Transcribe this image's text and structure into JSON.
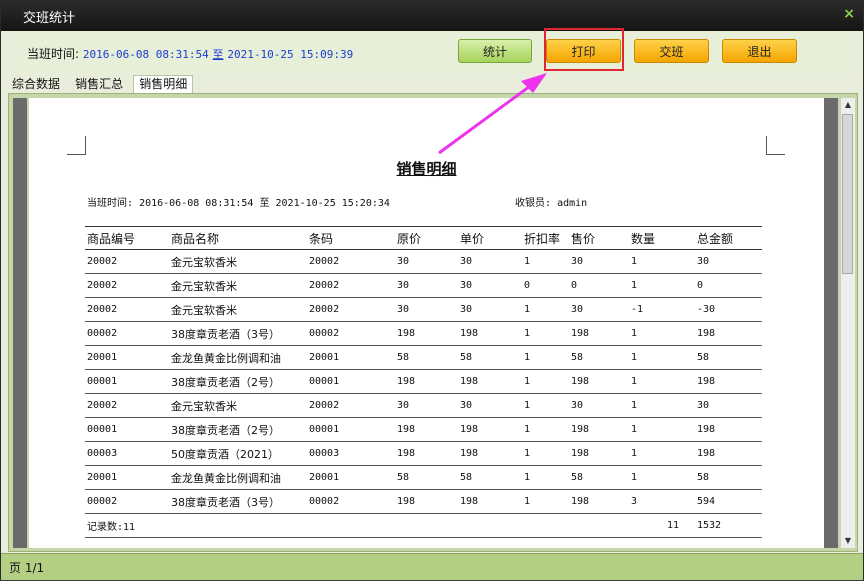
{
  "window": {
    "title": "交班统计",
    "close_icon": "×"
  },
  "toolbar": {
    "shift_label": "当班时间:",
    "start": "2016-06-08 08:31:54",
    "to": "至",
    "end": "2021-10-25 15:09:39",
    "btn_stats": "统计",
    "btn_print": "打印",
    "btn_handover": "交班",
    "btn_exit": "退出"
  },
  "tabs": [
    "综合数据",
    "销售汇总",
    "销售明细"
  ],
  "report": {
    "title": "销售明细",
    "shift_label": "当班时间:",
    "start": "2016-06-08 08:31:54",
    "to": "至",
    "end": "2021-10-25 15:20:34",
    "cashier_label": "收银员:",
    "cashier": "admin",
    "columns": [
      "商品编号",
      "商品名称",
      "条码",
      "原价",
      "单价",
      "折扣率",
      "售价",
      "数量",
      "总金额"
    ],
    "rows": [
      [
        "20002",
        "金元宝软香米",
        "20002",
        "30",
        "30",
        "1",
        "30",
        "1",
        "30"
      ],
      [
        "20002",
        "金元宝软香米",
        "20002",
        "30",
        "30",
        "0",
        "0",
        "1",
        "0"
      ],
      [
        "20002",
        "金元宝软香米",
        "20002",
        "30",
        "30",
        "1",
        "30",
        "-1",
        "-30"
      ],
      [
        "00002",
        "38度章贡老酒（3号）",
        "00002",
        "198",
        "198",
        "1",
        "198",
        "1",
        "198"
      ],
      [
        "20001",
        "金龙鱼黄金比例调和油",
        "20001",
        "58",
        "58",
        "1",
        "58",
        "1",
        "58"
      ],
      [
        "00001",
        "38度章贡老酒（2号）",
        "00001",
        "198",
        "198",
        "1",
        "198",
        "1",
        "198"
      ],
      [
        "20002",
        "金元宝软香米",
        "20002",
        "30",
        "30",
        "1",
        "30",
        "1",
        "30"
      ],
      [
        "00001",
        "38度章贡老酒（2号）",
        "00001",
        "198",
        "198",
        "1",
        "198",
        "1",
        "198"
      ],
      [
        "00003",
        "50度章贡酒（2021）",
        "00003",
        "198",
        "198",
        "1",
        "198",
        "1",
        "198"
      ],
      [
        "20001",
        "金龙鱼黄金比例调和油",
        "20001",
        "58",
        "58",
        "1",
        "58",
        "1",
        "58"
      ],
      [
        "00002",
        "38度章贡老酒（3号）",
        "00002",
        "198",
        "198",
        "1",
        "198",
        "3",
        "594"
      ]
    ],
    "record_count_label": "记录数:11",
    "total_qty": "11",
    "total_amount": "1532"
  },
  "status": {
    "page": "页 1/1"
  },
  "colors": {
    "highlight": "#e0262f",
    "arrow": "#ee33ee",
    "accent_orange": "#f4a400"
  }
}
